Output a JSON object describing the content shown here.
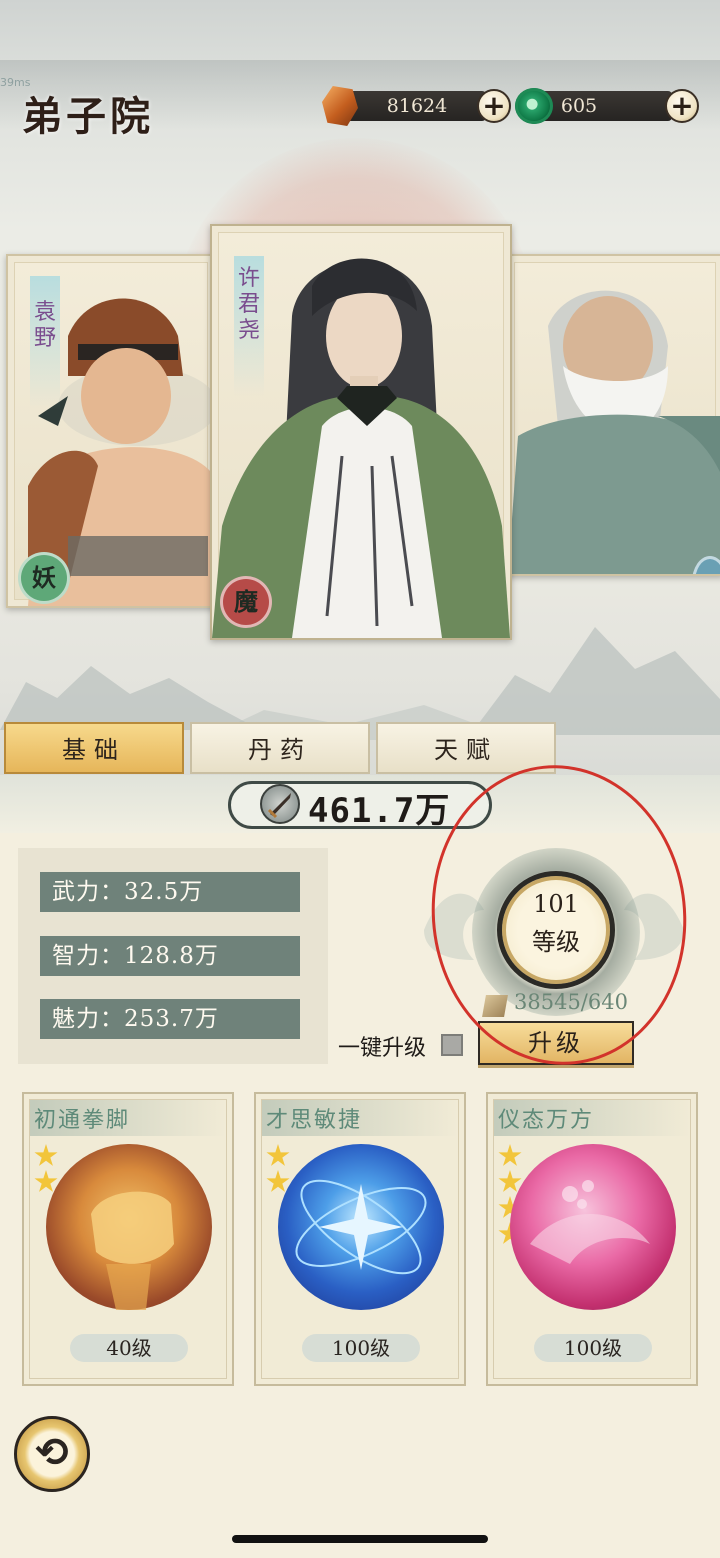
{
  "header": {
    "fps": "39ms",
    "title": "弟子院",
    "currency_1": {
      "icon": "amber-gem-icon",
      "value": "81624",
      "add_label": "+"
    },
    "currency_2": {
      "icon": "jade-coin-icon",
      "value": "605",
      "add_label": "+"
    }
  },
  "characters": [
    {
      "name": "袁野",
      "seal": "妖",
      "seal_color": "#5ea878"
    },
    {
      "name": "许君尧",
      "seal": "魔",
      "seal_color": "#b64b48"
    },
    {
      "name": "",
      "seal": "",
      "seal_color": "#6aa0b4"
    }
  ],
  "tabs": [
    {
      "label": "基础",
      "active": true
    },
    {
      "label": "丹药",
      "active": false
    },
    {
      "label": "天赋",
      "active": false
    }
  ],
  "power": {
    "icon": "sword-icon",
    "value": "461.7万"
  },
  "stats": [
    {
      "label": "武力：32.5万"
    },
    {
      "label": "智力：128.8万"
    },
    {
      "label": "魅力：253.7万"
    }
  ],
  "level": {
    "number": "101",
    "label": "等级",
    "exp_text": "38545/640",
    "exp_icon": "scroll-icon"
  },
  "upgrade": {
    "one_click_label": "一键升级",
    "one_click_checked": false,
    "button_label": "升级"
  },
  "skills": [
    {
      "title": "初通拳脚",
      "stars": 2,
      "level": "40级",
      "orb_icon": "fist-icon"
    },
    {
      "title": "才思敏捷",
      "stars": 2,
      "level": "100级",
      "orb_icon": "star-orbit-icon"
    },
    {
      "title": "仪态万方",
      "stars": 4,
      "level": "100级",
      "orb_icon": "pink-swirl-icon"
    }
  ],
  "colors": {
    "accent_gold": "#e6b65a",
    "stat_green": "#6f827a",
    "annotation_red": "#d2332b"
  }
}
